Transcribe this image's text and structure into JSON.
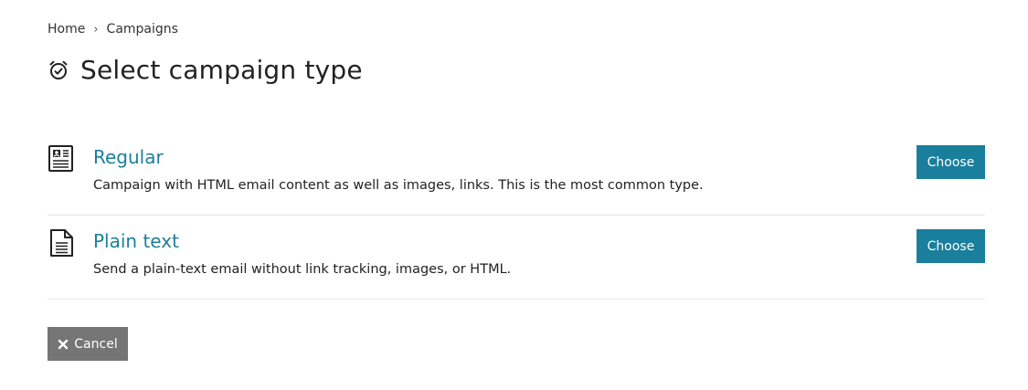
{
  "breadcrumb": {
    "home": "Home",
    "separator": "›",
    "current": "Campaigns"
  },
  "page": {
    "title": "Select campaign type",
    "title_icon": "alarm-clock-check-icon"
  },
  "campaign_types": [
    {
      "name": "Regular",
      "description": "Campaign with HTML email content as well as images, links. This is the most common type.",
      "icon": "newspaper-icon",
      "button_label": "Choose"
    },
    {
      "name": "Plain text",
      "description": "Send a plain-text email without link tracking, images, or HTML.",
      "icon": "text-document-icon",
      "button_label": "Choose"
    }
  ],
  "cancel": {
    "label": "Cancel",
    "icon": "close-icon"
  },
  "colors": {
    "accent": "#1a7f9c",
    "link": "#1d7f9a",
    "cancel_bg": "#757575",
    "divider": "#e6e6e6"
  }
}
